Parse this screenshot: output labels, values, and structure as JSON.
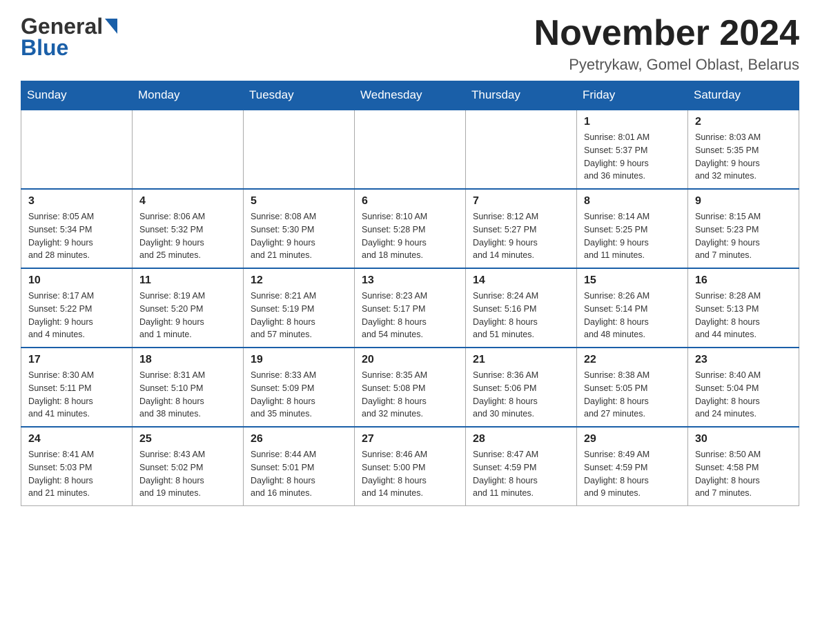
{
  "header": {
    "logo_general": "General",
    "logo_blue": "Blue",
    "month_title": "November 2024",
    "location": "Pyetrykaw, Gomel Oblast, Belarus"
  },
  "weekdays": [
    "Sunday",
    "Monday",
    "Tuesday",
    "Wednesday",
    "Thursday",
    "Friday",
    "Saturday"
  ],
  "weeks": [
    [
      {
        "day": "",
        "info": ""
      },
      {
        "day": "",
        "info": ""
      },
      {
        "day": "",
        "info": ""
      },
      {
        "day": "",
        "info": ""
      },
      {
        "day": "",
        "info": ""
      },
      {
        "day": "1",
        "info": "Sunrise: 8:01 AM\nSunset: 5:37 PM\nDaylight: 9 hours\nand 36 minutes."
      },
      {
        "day": "2",
        "info": "Sunrise: 8:03 AM\nSunset: 5:35 PM\nDaylight: 9 hours\nand 32 minutes."
      }
    ],
    [
      {
        "day": "3",
        "info": "Sunrise: 8:05 AM\nSunset: 5:34 PM\nDaylight: 9 hours\nand 28 minutes."
      },
      {
        "day": "4",
        "info": "Sunrise: 8:06 AM\nSunset: 5:32 PM\nDaylight: 9 hours\nand 25 minutes."
      },
      {
        "day": "5",
        "info": "Sunrise: 8:08 AM\nSunset: 5:30 PM\nDaylight: 9 hours\nand 21 minutes."
      },
      {
        "day": "6",
        "info": "Sunrise: 8:10 AM\nSunset: 5:28 PM\nDaylight: 9 hours\nand 18 minutes."
      },
      {
        "day": "7",
        "info": "Sunrise: 8:12 AM\nSunset: 5:27 PM\nDaylight: 9 hours\nand 14 minutes."
      },
      {
        "day": "8",
        "info": "Sunrise: 8:14 AM\nSunset: 5:25 PM\nDaylight: 9 hours\nand 11 minutes."
      },
      {
        "day": "9",
        "info": "Sunrise: 8:15 AM\nSunset: 5:23 PM\nDaylight: 9 hours\nand 7 minutes."
      }
    ],
    [
      {
        "day": "10",
        "info": "Sunrise: 8:17 AM\nSunset: 5:22 PM\nDaylight: 9 hours\nand 4 minutes."
      },
      {
        "day": "11",
        "info": "Sunrise: 8:19 AM\nSunset: 5:20 PM\nDaylight: 9 hours\nand 1 minute."
      },
      {
        "day": "12",
        "info": "Sunrise: 8:21 AM\nSunset: 5:19 PM\nDaylight: 8 hours\nand 57 minutes."
      },
      {
        "day": "13",
        "info": "Sunrise: 8:23 AM\nSunset: 5:17 PM\nDaylight: 8 hours\nand 54 minutes."
      },
      {
        "day": "14",
        "info": "Sunrise: 8:24 AM\nSunset: 5:16 PM\nDaylight: 8 hours\nand 51 minutes."
      },
      {
        "day": "15",
        "info": "Sunrise: 8:26 AM\nSunset: 5:14 PM\nDaylight: 8 hours\nand 48 minutes."
      },
      {
        "day": "16",
        "info": "Sunrise: 8:28 AM\nSunset: 5:13 PM\nDaylight: 8 hours\nand 44 minutes."
      }
    ],
    [
      {
        "day": "17",
        "info": "Sunrise: 8:30 AM\nSunset: 5:11 PM\nDaylight: 8 hours\nand 41 minutes."
      },
      {
        "day": "18",
        "info": "Sunrise: 8:31 AM\nSunset: 5:10 PM\nDaylight: 8 hours\nand 38 minutes."
      },
      {
        "day": "19",
        "info": "Sunrise: 8:33 AM\nSunset: 5:09 PM\nDaylight: 8 hours\nand 35 minutes."
      },
      {
        "day": "20",
        "info": "Sunrise: 8:35 AM\nSunset: 5:08 PM\nDaylight: 8 hours\nand 32 minutes."
      },
      {
        "day": "21",
        "info": "Sunrise: 8:36 AM\nSunset: 5:06 PM\nDaylight: 8 hours\nand 30 minutes."
      },
      {
        "day": "22",
        "info": "Sunrise: 8:38 AM\nSunset: 5:05 PM\nDaylight: 8 hours\nand 27 minutes."
      },
      {
        "day": "23",
        "info": "Sunrise: 8:40 AM\nSunset: 5:04 PM\nDaylight: 8 hours\nand 24 minutes."
      }
    ],
    [
      {
        "day": "24",
        "info": "Sunrise: 8:41 AM\nSunset: 5:03 PM\nDaylight: 8 hours\nand 21 minutes."
      },
      {
        "day": "25",
        "info": "Sunrise: 8:43 AM\nSunset: 5:02 PM\nDaylight: 8 hours\nand 19 minutes."
      },
      {
        "day": "26",
        "info": "Sunrise: 8:44 AM\nSunset: 5:01 PM\nDaylight: 8 hours\nand 16 minutes."
      },
      {
        "day": "27",
        "info": "Sunrise: 8:46 AM\nSunset: 5:00 PM\nDaylight: 8 hours\nand 14 minutes."
      },
      {
        "day": "28",
        "info": "Sunrise: 8:47 AM\nSunset: 4:59 PM\nDaylight: 8 hours\nand 11 minutes."
      },
      {
        "day": "29",
        "info": "Sunrise: 8:49 AM\nSunset: 4:59 PM\nDaylight: 8 hours\nand 9 minutes."
      },
      {
        "day": "30",
        "info": "Sunrise: 8:50 AM\nSunset: 4:58 PM\nDaylight: 8 hours\nand 7 minutes."
      }
    ]
  ]
}
